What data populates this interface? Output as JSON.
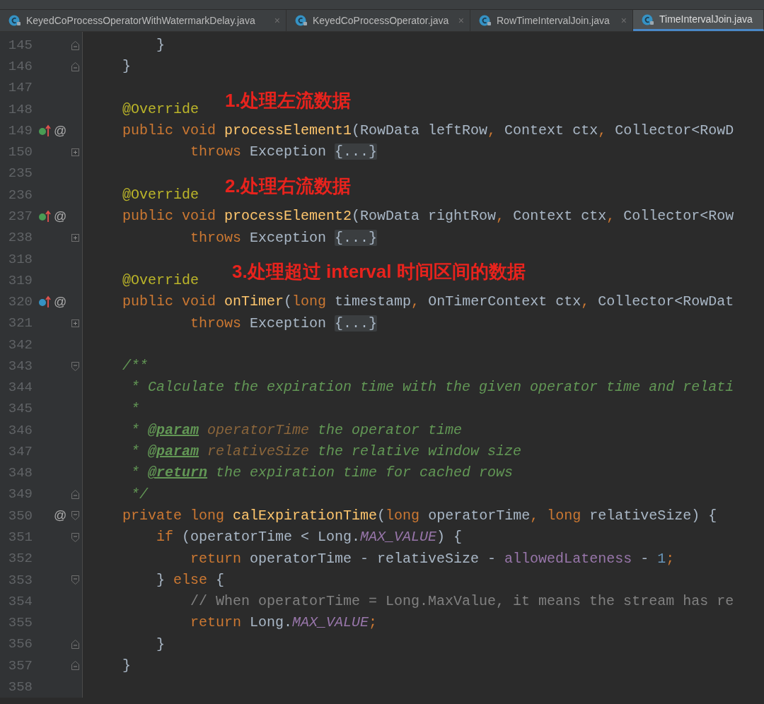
{
  "tabs": [
    {
      "label": "KeyedCoProcessOperatorWithWatermarkDelay.java",
      "selected": false,
      "close": "×"
    },
    {
      "label": "KeyedCoProcessOperator.java",
      "selected": false,
      "close": "×"
    },
    {
      "label": "RowTimeIntervalJoin.java",
      "selected": false,
      "close": "×"
    },
    {
      "label": "TimeIntervalJoin.java",
      "selected": true
    }
  ],
  "editor": {
    "lines": [
      {
        "number": "145",
        "fold": {
          "kind": "end"
        },
        "tokens": [
          {
            "kind": "plain",
            "text": "        }"
          }
        ]
      },
      {
        "number": "146",
        "fold": {
          "kind": "end"
        },
        "tokens": [
          {
            "kind": "plain",
            "text": "    }"
          }
        ]
      },
      {
        "number": "147"
      },
      {
        "number": "148",
        "tokens": [
          {
            "kind": "annotation",
            "text": "    @Override"
          }
        ],
        "note": "1.处理左流数据"
      },
      {
        "number": "149",
        "marker": {
          "kind": "implementing"
        },
        "at": "@",
        "tokens": [
          {
            "kind": "keyword",
            "text": "    public void "
          },
          {
            "kind": "method",
            "text": "processElement1"
          },
          {
            "kind": "plain",
            "text": "(RowData leftRow"
          },
          {
            "kind": "keyword",
            "text": ", "
          },
          {
            "kind": "plain",
            "text": "Context ctx"
          },
          {
            "kind": "keyword",
            "text": ", "
          },
          {
            "kind": "plain",
            "text": "Collector<RowD"
          }
        ]
      },
      {
        "number": "150",
        "fold": {
          "kind": "collapsed"
        },
        "tokens": [
          {
            "kind": "keyword",
            "text": "            throws "
          },
          {
            "kind": "plain",
            "text": "Exception "
          },
          {
            "kind": "folded",
            "text": "{...}"
          }
        ]
      },
      {
        "number": "235"
      },
      {
        "number": "236",
        "tokens": [
          {
            "kind": "annotation",
            "text": "    @Override"
          }
        ],
        "note": "2.处理右流数据"
      },
      {
        "number": "237",
        "marker": {
          "kind": "implementing"
        },
        "at": "@",
        "tokens": [
          {
            "kind": "keyword",
            "text": "    public void "
          },
          {
            "kind": "method",
            "text": "processElement2"
          },
          {
            "kind": "plain",
            "text": "(RowData rightRow"
          },
          {
            "kind": "keyword",
            "text": ", "
          },
          {
            "kind": "plain",
            "text": "Context ctx"
          },
          {
            "kind": "keyword",
            "text": ", "
          },
          {
            "kind": "plain",
            "text": "Collector<Row"
          }
        ]
      },
      {
        "number": "238",
        "fold": {
          "kind": "collapsed"
        },
        "tokens": [
          {
            "kind": "keyword",
            "text": "            throws "
          },
          {
            "kind": "plain",
            "text": "Exception "
          },
          {
            "kind": "folded",
            "text": "{...}"
          }
        ]
      },
      {
        "number": "318"
      },
      {
        "number": "319",
        "tokens": [
          {
            "kind": "annotation",
            "text": "    @Override"
          }
        ],
        "note": "3.处理超过 interval 时间区间的数据"
      },
      {
        "number": "320",
        "marker": {
          "kind": "overriding"
        },
        "at": "@",
        "tokens": [
          {
            "kind": "keyword",
            "text": "    public void "
          },
          {
            "kind": "method",
            "text": "onTimer"
          },
          {
            "kind": "plain",
            "text": "("
          },
          {
            "kind": "keyword",
            "text": "long "
          },
          {
            "kind": "plain",
            "text": "timestamp"
          },
          {
            "kind": "keyword",
            "text": ", "
          },
          {
            "kind": "plain",
            "text": "OnTimerContext ctx"
          },
          {
            "kind": "keyword",
            "text": ", "
          },
          {
            "kind": "plain",
            "text": "Collector<RowDat"
          }
        ]
      },
      {
        "number": "321",
        "fold": {
          "kind": "collapsed"
        },
        "tokens": [
          {
            "kind": "keyword",
            "text": "            throws "
          },
          {
            "kind": "plain",
            "text": "Exception "
          },
          {
            "kind": "folded",
            "text": "{...}"
          }
        ]
      },
      {
        "number": "342"
      },
      {
        "number": "343",
        "fold": {
          "kind": "start"
        },
        "tokens": [
          {
            "kind": "doc",
            "text": "    /**"
          }
        ]
      },
      {
        "number": "344",
        "tokens": [
          {
            "kind": "doc",
            "text": "     * Calculate the expiration time with the given operator time and relati"
          }
        ]
      },
      {
        "number": "345",
        "tokens": [
          {
            "kind": "doc",
            "text": "     *"
          }
        ]
      },
      {
        "number": "346",
        "tokens": [
          {
            "kind": "doc",
            "text": "     * "
          },
          {
            "kind": "doctag",
            "text": "@param"
          },
          {
            "kind": "docparam",
            "text": " operatorTime"
          },
          {
            "kind": "doc",
            "text": " the operator time"
          }
        ]
      },
      {
        "number": "347",
        "tokens": [
          {
            "kind": "doc",
            "text": "     * "
          },
          {
            "kind": "doctag",
            "text": "@param"
          },
          {
            "kind": "docparam",
            "text": " relativeSize"
          },
          {
            "kind": "doc",
            "text": " the relative window size"
          }
        ]
      },
      {
        "number": "348",
        "tokens": [
          {
            "kind": "doc",
            "text": "     * "
          },
          {
            "kind": "doctag",
            "text": "@return"
          },
          {
            "kind": "doc",
            "text": " the expiration time for cached rows"
          }
        ]
      },
      {
        "number": "349",
        "fold": {
          "kind": "end"
        },
        "tokens": [
          {
            "kind": "doc",
            "text": "     */"
          }
        ]
      },
      {
        "number": "350",
        "at": "@",
        "fold": {
          "kind": "start"
        },
        "tokens": [
          {
            "kind": "keyword",
            "text": "    private long "
          },
          {
            "kind": "method",
            "text": "calExpirationTime"
          },
          {
            "kind": "plain",
            "text": "("
          },
          {
            "kind": "keyword",
            "text": "long "
          },
          {
            "kind": "plain",
            "text": "operatorTime"
          },
          {
            "kind": "keyword",
            "text": ", long "
          },
          {
            "kind": "plain",
            "text": "relativeSize) {"
          }
        ]
      },
      {
        "number": "351",
        "fold": {
          "kind": "start"
        },
        "tokens": [
          {
            "kind": "keyword",
            "text": "        if "
          },
          {
            "kind": "plain",
            "text": "(operatorTime < Long."
          },
          {
            "kind": "constant",
            "text": "MAX_VALUE"
          },
          {
            "kind": "plain",
            "text": ") {"
          }
        ]
      },
      {
        "number": "352",
        "tokens": [
          {
            "kind": "keyword",
            "text": "            return "
          },
          {
            "kind": "plain",
            "text": "operatorTime - relativeSize - "
          },
          {
            "kind": "field",
            "text": "allowedLateness"
          },
          {
            "kind": "plain",
            "text": " - "
          },
          {
            "kind": "number",
            "text": "1"
          },
          {
            "kind": "keyword",
            "text": ";"
          }
        ]
      },
      {
        "number": "353",
        "fold": {
          "kind": "start"
        },
        "tokens": [
          {
            "kind": "plain",
            "text": "        } "
          },
          {
            "kind": "keyword",
            "text": "else "
          },
          {
            "kind": "plain",
            "text": "{"
          }
        ]
      },
      {
        "number": "354",
        "tokens": [
          {
            "kind": "comment",
            "text": "            // When operatorTime = Long.MaxValue, it means the stream has re"
          }
        ]
      },
      {
        "number": "355",
        "tokens": [
          {
            "kind": "keyword",
            "text": "            return "
          },
          {
            "kind": "plain",
            "text": "Long."
          },
          {
            "kind": "constant",
            "text": "MAX_VALUE"
          },
          {
            "kind": "keyword",
            "text": ";"
          }
        ]
      },
      {
        "number": "356",
        "fold": {
          "kind": "end"
        },
        "tokens": [
          {
            "kind": "plain",
            "text": "        }"
          }
        ]
      },
      {
        "number": "357",
        "fold": {
          "kind": "end"
        },
        "tokens": [
          {
            "kind": "plain",
            "text": "    }"
          }
        ]
      },
      {
        "number": "358"
      }
    ]
  }
}
